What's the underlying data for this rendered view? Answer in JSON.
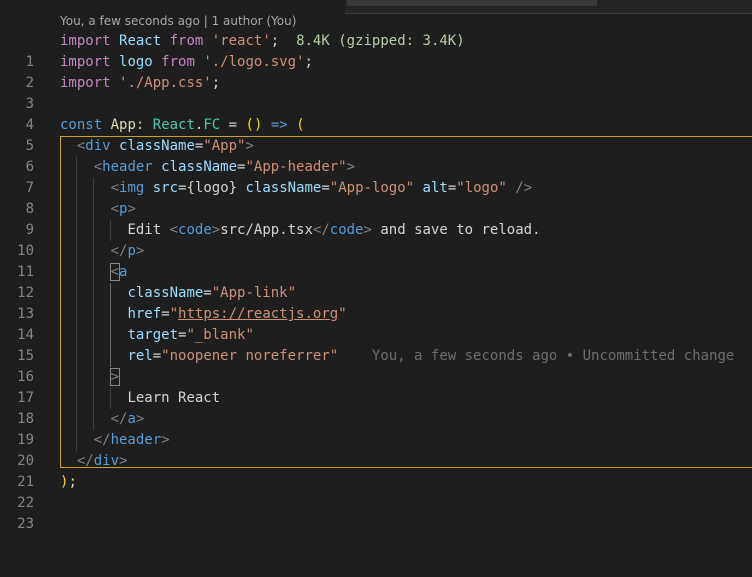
{
  "codelens": "You, a few seconds ago | 1 author (You)",
  "import_size": "8.4K (gzipped: 3.4K)",
  "blame": "You, a few seconds ago • Uncommitted change",
  "lines": [
    {
      "n": "1"
    },
    {
      "n": "2"
    },
    {
      "n": "3"
    },
    {
      "n": "4"
    },
    {
      "n": "5"
    },
    {
      "n": "6"
    },
    {
      "n": "7"
    },
    {
      "n": "8"
    },
    {
      "n": "9"
    },
    {
      "n": "10"
    },
    {
      "n": "11"
    },
    {
      "n": "12"
    },
    {
      "n": "13"
    },
    {
      "n": "14"
    },
    {
      "n": "15"
    },
    {
      "n": "16"
    },
    {
      "n": "17"
    },
    {
      "n": "18"
    },
    {
      "n": "19"
    },
    {
      "n": "20"
    },
    {
      "n": "21"
    },
    {
      "n": "22"
    },
    {
      "n": "23"
    }
  ],
  "tokens": {
    "import": "import",
    "from": "from",
    "react_id": "React",
    "react_str": "'react'",
    "semi": ";",
    "logo_id": "logo",
    "logo_str": "'./logo.svg'",
    "css_str": "'./App.css'",
    "const": "const",
    "app": "App",
    "colon": ":",
    "react_ns": "React",
    "dot": ".",
    "fc": "FC",
    "eq": "=",
    "arrow_params": "()",
    "arrow": "=>",
    "open_paren": "(",
    "close_paren": ")",
    "lt": "<",
    "gt": ">",
    "lts": "</",
    "sgt": "/>",
    "div": "div",
    "header": "header",
    "img": "img",
    "p": "p",
    "code": "code",
    "a": "a",
    "classname": "className",
    "src": "src",
    "alt": "alt",
    "href": "href",
    "target": "target",
    "rel": "rel",
    "eqs": "=",
    "app_cls": "\"App\"",
    "header_cls": "\"App-header\"",
    "src_val": "{logo}",
    "logo_cls": "\"App-logo\"",
    "alt_val": "\"logo\"",
    "edit_text": "Edit ",
    "code_text": "src/App.tsx",
    "save_text": " and save to reload.",
    "link_cls": "\"App-link\"",
    "q": "\"",
    "href_url": "https://reactjs.org",
    "target_val": "\"_blank\"",
    "rel_val": "\"noopener noreferrer\"",
    "learn": "Learn React"
  }
}
